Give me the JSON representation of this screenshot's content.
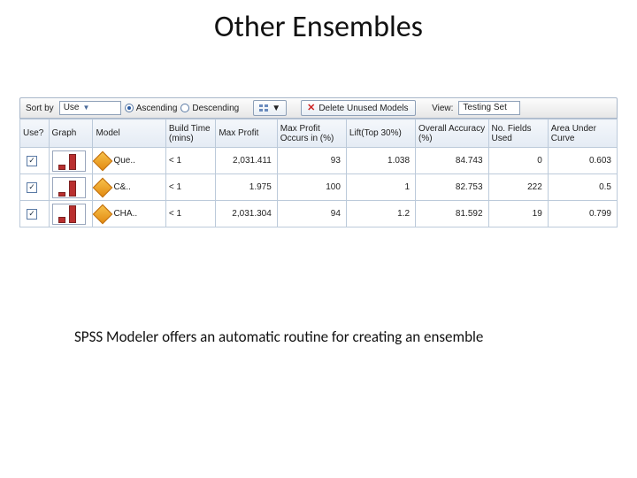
{
  "title": "Other Ensembles",
  "caption": "SPSS Modeler offers an automatic routine for creating an ensemble",
  "toolbar": {
    "sort_by_label": "Sort by",
    "sort_by_value": "Use",
    "asc_label": "Ascending",
    "desc_label": "Descending",
    "delete_label": "Delete Unused Models",
    "view_label": "View:",
    "view_value": "Testing Set"
  },
  "cols": {
    "use": "Use?",
    "graph": "Graph",
    "model": "Model",
    "build_time": "Build Time (mins)",
    "max_profit": "Max Profit",
    "max_profit_occurs": "Max Profit Occurs in (%)",
    "lift": "Lift(Top 30%)",
    "accuracy": "Overall Accuracy (%)",
    "fields": "No. Fields Used",
    "auc": "Area Under Curve"
  },
  "rows": [
    {
      "model": "Que..",
      "build_time": "< 1",
      "max_profit": "2,031.411",
      "max_profit_occurs": "93",
      "lift": "1.038",
      "accuracy": "84.743",
      "fields": "0",
      "auc": "0.603",
      "bar1_h": 6,
      "bar2_h": 18
    },
    {
      "model": "C&..",
      "build_time": "< 1",
      "max_profit": "1.975",
      "max_profit_occurs": "100",
      "lift": "1",
      "accuracy": "82.753",
      "fields": "222",
      "auc": "0.5",
      "bar1_h": 5,
      "bar2_h": 18
    },
    {
      "model": "CHA..",
      "build_time": "< 1",
      "max_profit": "2,031.304",
      "max_profit_occurs": "94",
      "lift": "1.2",
      "accuracy": "81.592",
      "fields": "19",
      "auc": "0.799",
      "bar1_h": 7,
      "bar2_h": 20
    }
  ]
}
